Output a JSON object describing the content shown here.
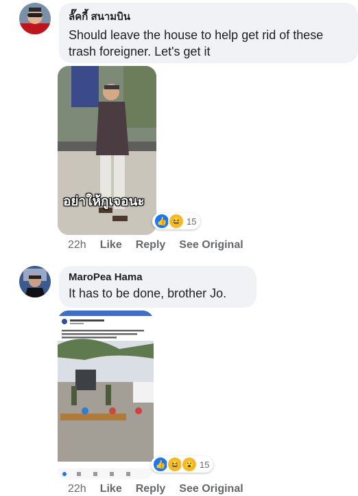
{
  "comments": [
    {
      "author": "ลั๊คกี้ สนามบิน",
      "text": "Should leave the house to help get rid of these trash foreigner. Let's get it",
      "image_caption": "อย่าให้กูเจอนะ",
      "reaction_count": "15",
      "time": "22h",
      "like": "Like",
      "reply": "Reply",
      "see_original": "See Original"
    },
    {
      "author": "MaroPea Hama",
      "text": "It has to be done, brother Jo.",
      "reaction_count": "15",
      "time": "22h",
      "like": "Like",
      "reply": "Reply",
      "see_original": "See Original"
    }
  ],
  "colors": {
    "bubble": "#f0f2f5",
    "muted": "#65676b",
    "like": "#1877f2",
    "haha": "#f7b928"
  }
}
